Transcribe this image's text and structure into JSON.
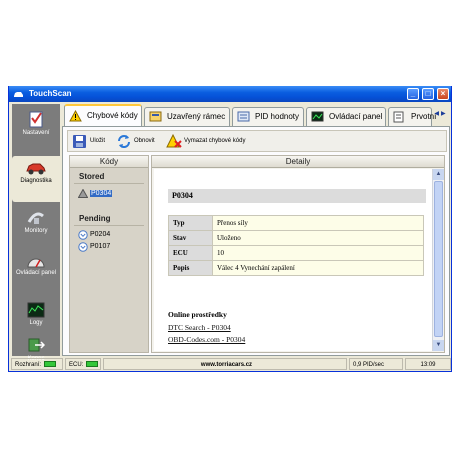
{
  "window": {
    "title": "TouchScan"
  },
  "sidebar": {
    "items": [
      {
        "label": "Nastavení",
        "icon": "settings-checklist-icon"
      },
      {
        "label": "Diagnostika",
        "icon": "car-icon"
      },
      {
        "label": "Monitory",
        "icon": "satellite-icon"
      },
      {
        "label": "Ovládací panel",
        "icon": "gauge-icon"
      },
      {
        "label": "Logy",
        "icon": "chart-icon"
      },
      {
        "label": "Konec",
        "icon": "exit-icon"
      }
    ]
  },
  "tabs": [
    {
      "label": "Chybové kódy",
      "icon": "warning-icon"
    },
    {
      "label": "Uzavřený rámec",
      "icon": "frame-icon"
    },
    {
      "label": "PID hodnoty",
      "icon": "values-icon"
    },
    {
      "label": "Ovládací panel",
      "icon": "dashboard-icon"
    },
    {
      "label": "Prvotní",
      "icon": "document-icon"
    }
  ],
  "toolbar": {
    "save_label": "Uložit",
    "refresh_label": "Obnovit",
    "clear_label": "Vymazat chybové kódy"
  },
  "codes_panel": {
    "header": "Kódy",
    "stored_title": "Stored",
    "stored_codes": [
      "P0304"
    ],
    "pending_title": "Pending",
    "pending_codes": [
      "P0204",
      "P0107"
    ]
  },
  "details": {
    "header": "Detaily",
    "code": "P0304",
    "rows": [
      {
        "key": "Typ",
        "value": "Přenos síly"
      },
      {
        "key": "Stav",
        "value": "Uloženo"
      },
      {
        "key": "ECU",
        "value": "10"
      },
      {
        "key": "Popis",
        "value": "Válec 4 Vynechání zapálení"
      }
    ],
    "online_title": "Online prostředky",
    "links": [
      "DTC Search - P0304",
      "OBD-Codes.com - P0304"
    ]
  },
  "statusbar": {
    "interface_label": "Rozhraní:",
    "ecu_label": "ECU:",
    "website": "www.torriacars.cz",
    "rate": "0,9 PID/sec",
    "time": "13:09"
  },
  "colors": {
    "titlebar": "#0a5ee0",
    "selection": "#316ac5",
    "status_led": "#34c73a",
    "active_tab_accent": "#ffc83c"
  }
}
